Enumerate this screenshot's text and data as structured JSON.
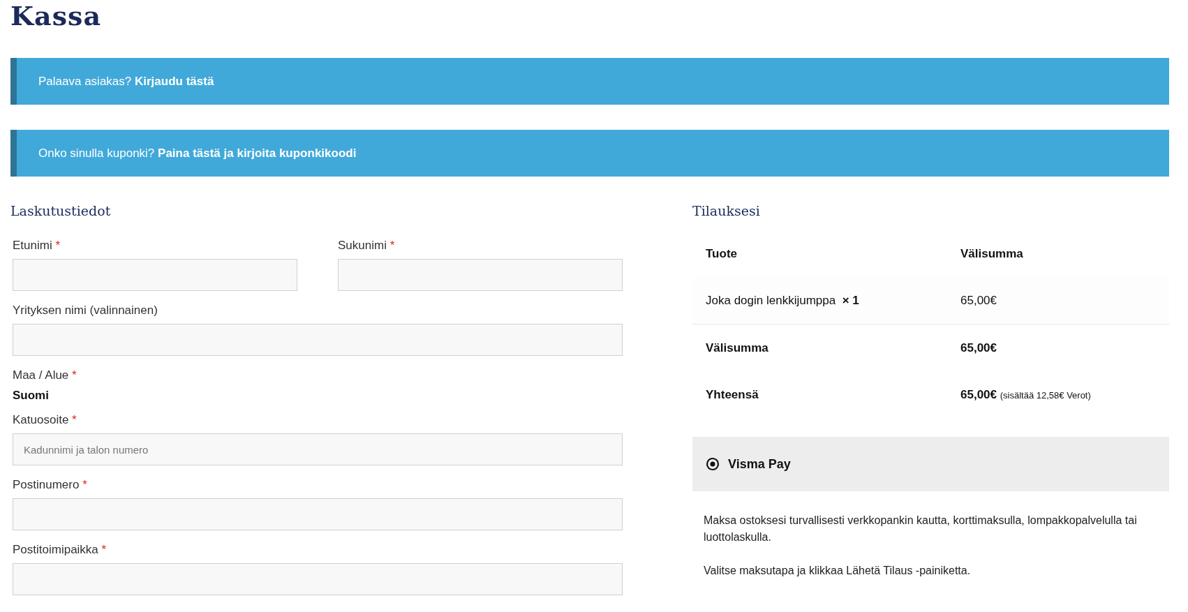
{
  "title": "Kassa",
  "notices": [
    {
      "text": "Palaava asiakas?",
      "link": "Kirjaudu tästä"
    },
    {
      "text": "Onko sinulla kuponki?",
      "link": "Paina tästä ja kirjoita kuponkikoodi"
    }
  ],
  "billing": {
    "heading": "Laskutustiedot",
    "fields": [
      {
        "kind": "input",
        "label": "Etunimi",
        "required_mark": "*",
        "half": true
      },
      {
        "kind": "input",
        "label": "Sukunimi",
        "required_mark": "*",
        "half": true
      },
      {
        "kind": "input",
        "label": "Yrityksen nimi (valinnainen)",
        "half": false
      },
      {
        "kind": "static",
        "label": "Maa / Alue",
        "required_mark": "*",
        "value": "Suomi"
      },
      {
        "kind": "input",
        "label": "Katuosoite",
        "required_mark": "*",
        "half": false,
        "placeholder": "Kadunnimi ja talon numero"
      },
      {
        "kind": "input",
        "label": "Postinumero",
        "required_mark": "*",
        "half": false
      },
      {
        "kind": "input",
        "label": "Postitoimipaikka",
        "required_mark": "*",
        "half": false
      }
    ]
  },
  "order": {
    "heading": "Tilauksesi",
    "columns": [
      "Tuote",
      "Välisumma"
    ],
    "items": [
      {
        "name": "Joka dogin lenkkijumppa",
        "quantity": "× 1",
        "price": "65,00€"
      }
    ],
    "subtotal": {
      "label": "Välisumma",
      "value": "65,00€"
    },
    "total": {
      "label": "Yhteensä",
      "value": "65,00€",
      "tax_note": "(sisältää 12,58€ Verot)"
    },
    "payment_methods": [
      {
        "name": "Visma Pay",
        "selected": true
      }
    ],
    "payment_description": [
      "Maksa ostoksesi turvallisesti verkkopankin kautta, korttimaksulla, lompakkopalvelulla tai luottolaskulla.",
      "Valitse maksutapa ja klikkaa Lähetä Tilaus -painiketta."
    ]
  }
}
